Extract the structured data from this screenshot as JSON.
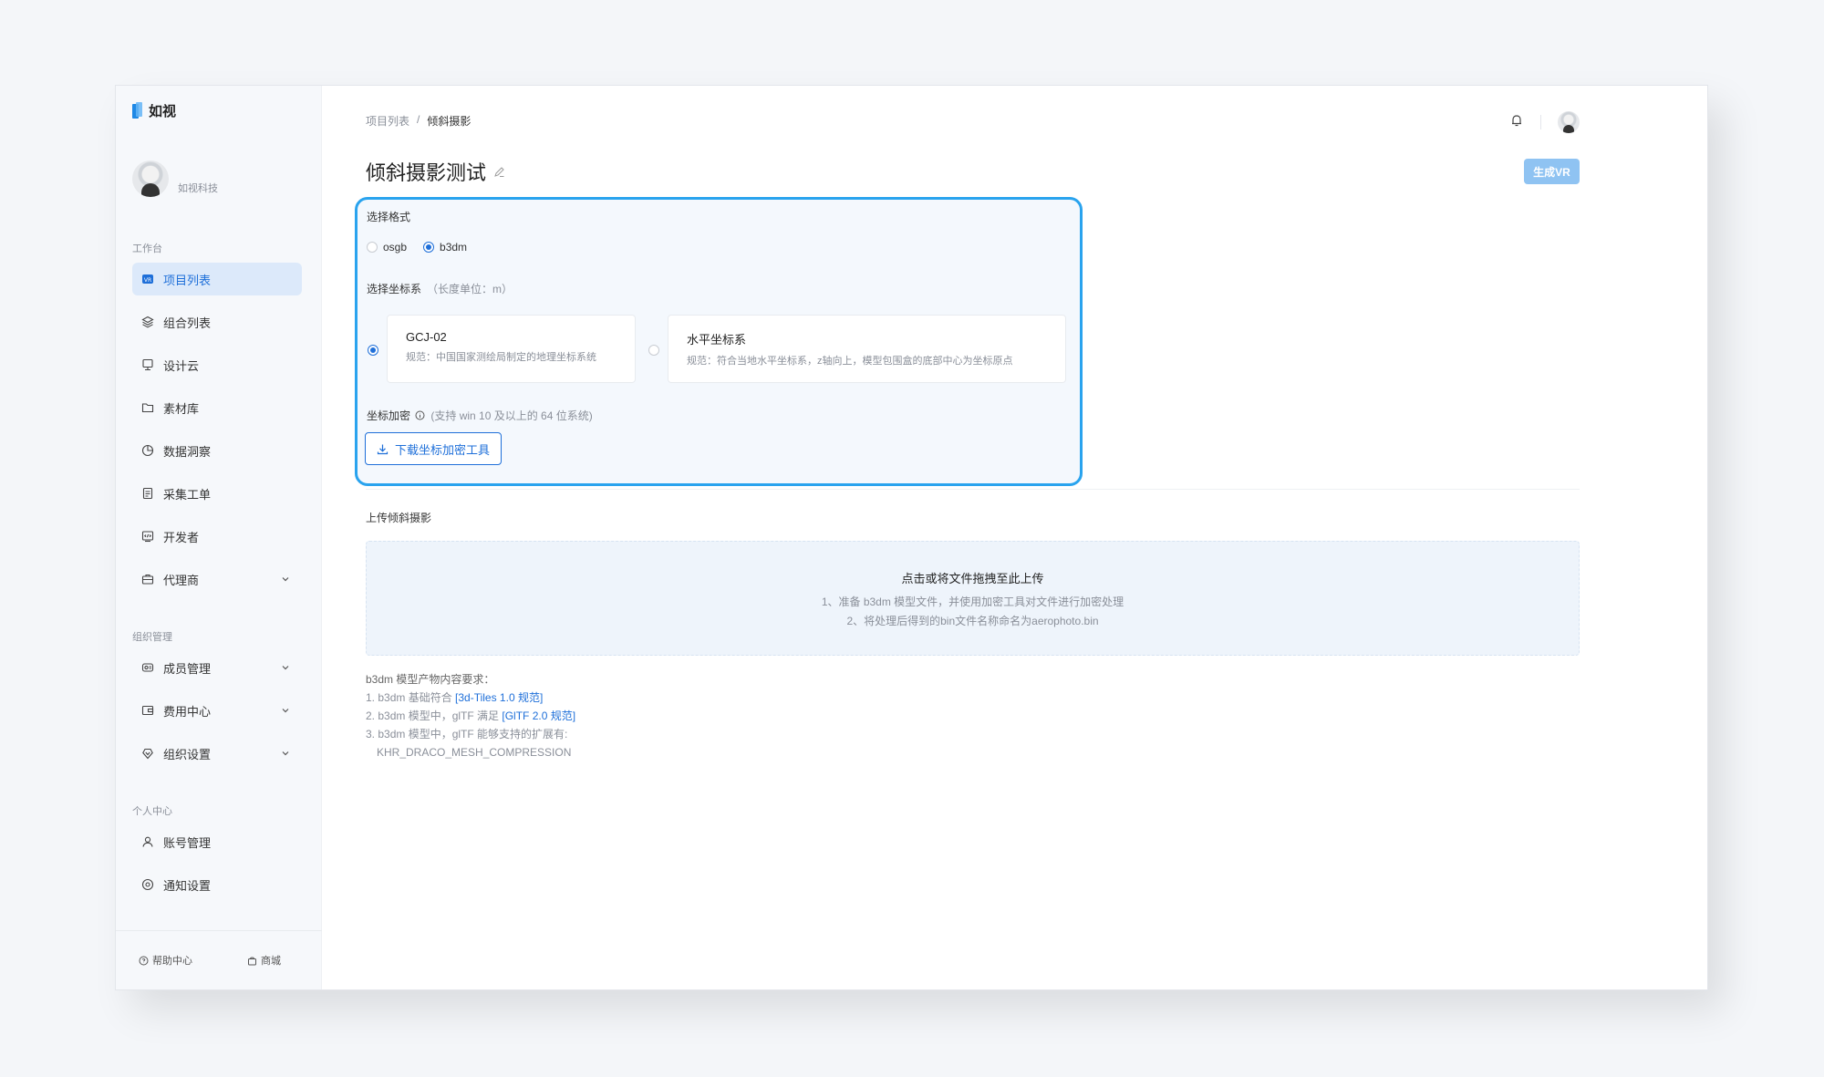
{
  "app": {
    "logo_text": "如视"
  },
  "profile": {
    "name": "如视科技"
  },
  "sidebar": {
    "sections": {
      "workbench": "工作台",
      "org": "组织管理",
      "personal": "个人中心"
    },
    "items": [
      {
        "label": "项目列表",
        "icon": "vr-icon"
      },
      {
        "label": "组合列表",
        "icon": "layers-icon"
      },
      {
        "label": "设计云",
        "icon": "monitor-icon"
      },
      {
        "label": "素材库",
        "icon": "folder-icon"
      },
      {
        "label": "数据洞察",
        "icon": "pie-icon"
      },
      {
        "label": "采集工单",
        "icon": "document-icon"
      },
      {
        "label": "开发者",
        "icon": "code-icon"
      },
      {
        "label": "代理商",
        "icon": "briefcase-icon"
      },
      {
        "label": "成员管理",
        "icon": "members-icon"
      },
      {
        "label": "费用中心",
        "icon": "wallet-icon"
      },
      {
        "label": "组织设置",
        "icon": "shield-icon"
      },
      {
        "label": "账号管理",
        "icon": "user-icon"
      },
      {
        "label": "通知设置",
        "icon": "settings-icon"
      }
    ],
    "footer": {
      "help": "帮助中心",
      "store": "商城"
    }
  },
  "breadcrumb": {
    "root": "项目列表",
    "sep": "/",
    "current": "倾斜摄影"
  },
  "page": {
    "title": "倾斜摄影测试",
    "vr_button": "生成VR"
  },
  "format": {
    "label": "选择格式",
    "options": [
      "osgb",
      "b3dm"
    ],
    "selected": "b3dm"
  },
  "coords": {
    "label": "选择坐标系",
    "hint": "（长度单位：m）",
    "options": [
      {
        "name": "GCJ-02",
        "desc": "规范：中国国家测绘局制定的地理坐标系统"
      },
      {
        "name": "水平坐标系",
        "desc": "规范：符合当地水平坐标系，z轴向上，模型包围盒的底部中心为坐标原点"
      }
    ],
    "selected": "GCJ-02"
  },
  "encrypt": {
    "label": "坐标加密",
    "hint": "(支持 win 10 及以上的 64 位系统)",
    "download_button": "下载坐标加密工具"
  },
  "upload": {
    "title": "上传倾斜摄影",
    "drop_main": "点击或将文件拖拽至此上传",
    "drop_line1": "1、准备 b3dm 模型文件，并使用加密工具对文件进行加密处理",
    "drop_line2": "2、将处理后得到的bin文件名称命名为aerophoto.bin"
  },
  "requirements": {
    "title": "b3dm 模型产物内容要求：",
    "r1_prefix": "1. b3dm 基础符合 ",
    "r1_link": "[3d-Tiles 1.0 规范]",
    "r2_prefix": "2. b3dm 模型中，glTF 满足 ",
    "r2_link": "[GlTF 2.0 规范]",
    "r3": "3. b3dm 模型中，glTF 能够支持的扩展有:",
    "r3_ext": "KHR_DRACO_MESH_COMPRESSION"
  },
  "colors": {
    "accent": "#1e6fd9",
    "highlight_border": "#29a3ee",
    "vr_button": "#8fc3f2"
  }
}
